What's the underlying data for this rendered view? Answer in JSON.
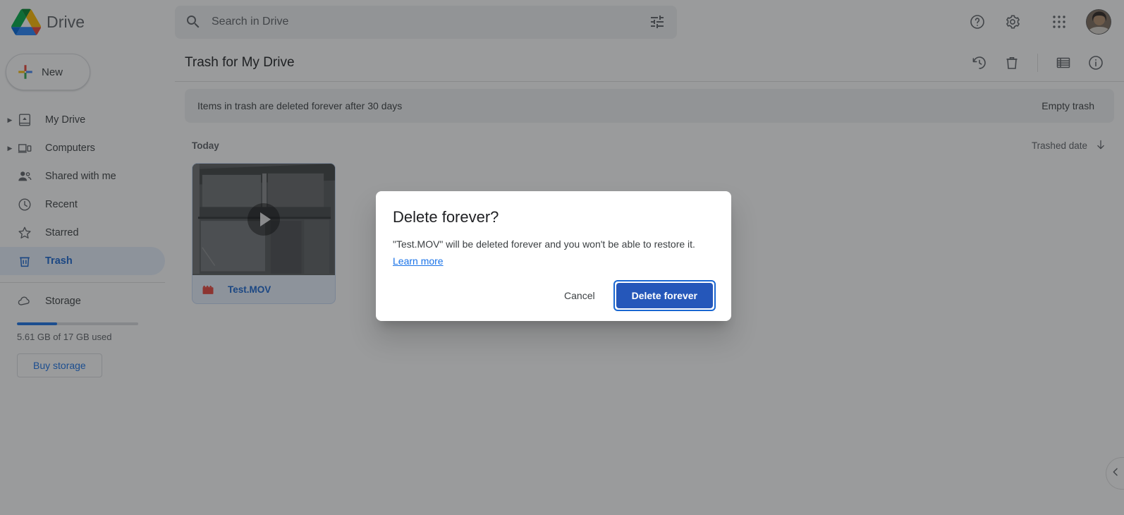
{
  "app": {
    "brand_name": "Drive"
  },
  "search": {
    "placeholder": "Search in Drive",
    "value": "",
    "icon": "search-icon",
    "filter_icon": "tune-icon"
  },
  "topbar": {
    "help_icon": "help-circle-icon",
    "settings_icon": "gear-icon",
    "apps_icon": "apps-grid-icon",
    "avatar_icon": "user-avatar"
  },
  "sidebar": {
    "new_button": "New",
    "items": [
      {
        "label": "My Drive",
        "icon": "my-drive-icon",
        "expandable": true,
        "active": false
      },
      {
        "label": "Computers",
        "icon": "computers-icon",
        "expandable": true,
        "active": false
      },
      {
        "label": "Shared with me",
        "icon": "shared-people-icon",
        "expandable": false,
        "active": false
      },
      {
        "label": "Recent",
        "icon": "clock-icon",
        "expandable": false,
        "active": false
      },
      {
        "label": "Starred",
        "icon": "star-icon",
        "expandable": false,
        "active": false
      },
      {
        "label": "Trash",
        "icon": "trash-icon",
        "expandable": false,
        "active": true
      }
    ],
    "storage": {
      "label": "Storage",
      "icon": "cloud-icon",
      "used_text": "5.61 GB of 17 GB used",
      "percent": 33,
      "buy_button": "Buy storage"
    }
  },
  "main": {
    "page_title": "Trash for My Drive",
    "header_icons": [
      {
        "name": "restore-icon"
      },
      {
        "name": "delete-forever-icon"
      },
      {
        "name": "list-view-icon"
      },
      {
        "name": "info-icon"
      }
    ],
    "banner_text": "Items in trash are deleted forever after 30 days",
    "empty_trash_button": "Empty trash",
    "section_title": "Today",
    "sort": {
      "label": "Trashed date",
      "direction_icon": "arrow-down-icon"
    },
    "files": [
      {
        "name": "Test.MOV",
        "type_icon": "video-clapperboard-icon",
        "selected": true,
        "has_play_overlay": true
      }
    ],
    "edge_expander_icon": "chevron-left-icon"
  },
  "dialog": {
    "title": "Delete forever?",
    "body": "\"Test.MOV\" will be deleted forever and you won't be able to restore it.",
    "learn_more": "Learn more",
    "cancel_button": "Cancel",
    "confirm_button": "Delete forever"
  },
  "colors": {
    "accent_blue": "#1a73e8",
    "active_blue": "#1967d2",
    "primary_button": "#2557ba",
    "selected_card_bg": "#e8f0fe",
    "text_primary": "#202124",
    "text_secondary": "#5f6368"
  }
}
